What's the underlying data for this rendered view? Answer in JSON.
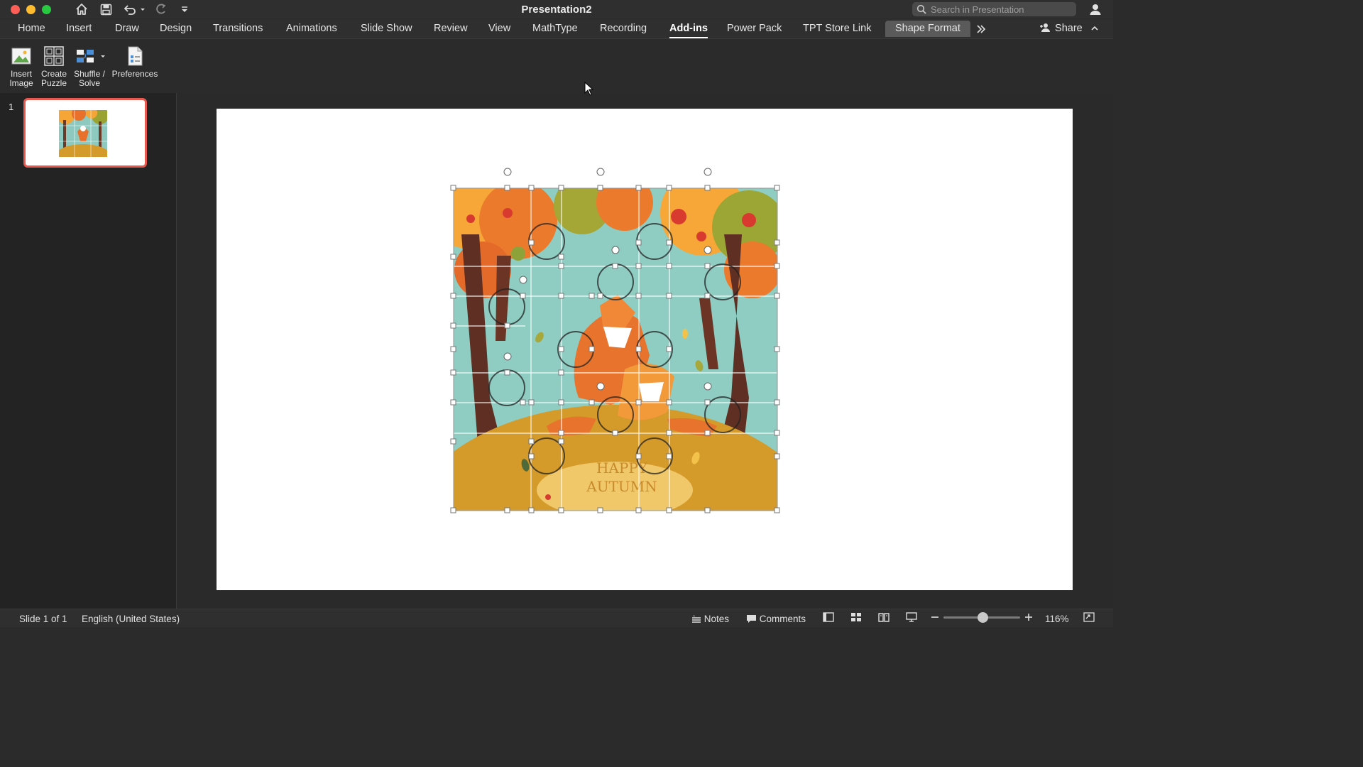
{
  "window": {
    "title": "Presentation2",
    "search_placeholder": "Search in Presentation"
  },
  "tabs": [
    "Home",
    "Insert",
    "Draw",
    "Design",
    "Transitions",
    "Animations",
    "Slide Show",
    "Review",
    "View",
    "MathType",
    "Recording",
    "Add-ins",
    "Power Pack",
    "TPT Store Link",
    "Shape Format"
  ],
  "active_tab": "Add-ins",
  "share_label": "Share",
  "ribbon": {
    "insert_image": [
      "Insert",
      "Image"
    ],
    "create_puzzle": [
      "Create",
      "Puzzle"
    ],
    "shuffle_solve": [
      "Shuffle /",
      "Solve"
    ],
    "preferences": "Preferences"
  },
  "thumbnails": {
    "slide_number": "1"
  },
  "slide": {
    "puzzle_text_line1": "HAPPY",
    "puzzle_text_line2": "AUTUMN"
  },
  "status": {
    "slide_position": "Slide 1 of 1",
    "language": "English (United States)",
    "notes_label": "Notes",
    "comments_label": "Comments",
    "zoom": "116%"
  },
  "colors": {
    "accent_red": "#e8584e",
    "selected_tab_bg": "#5a5a5a"
  }
}
